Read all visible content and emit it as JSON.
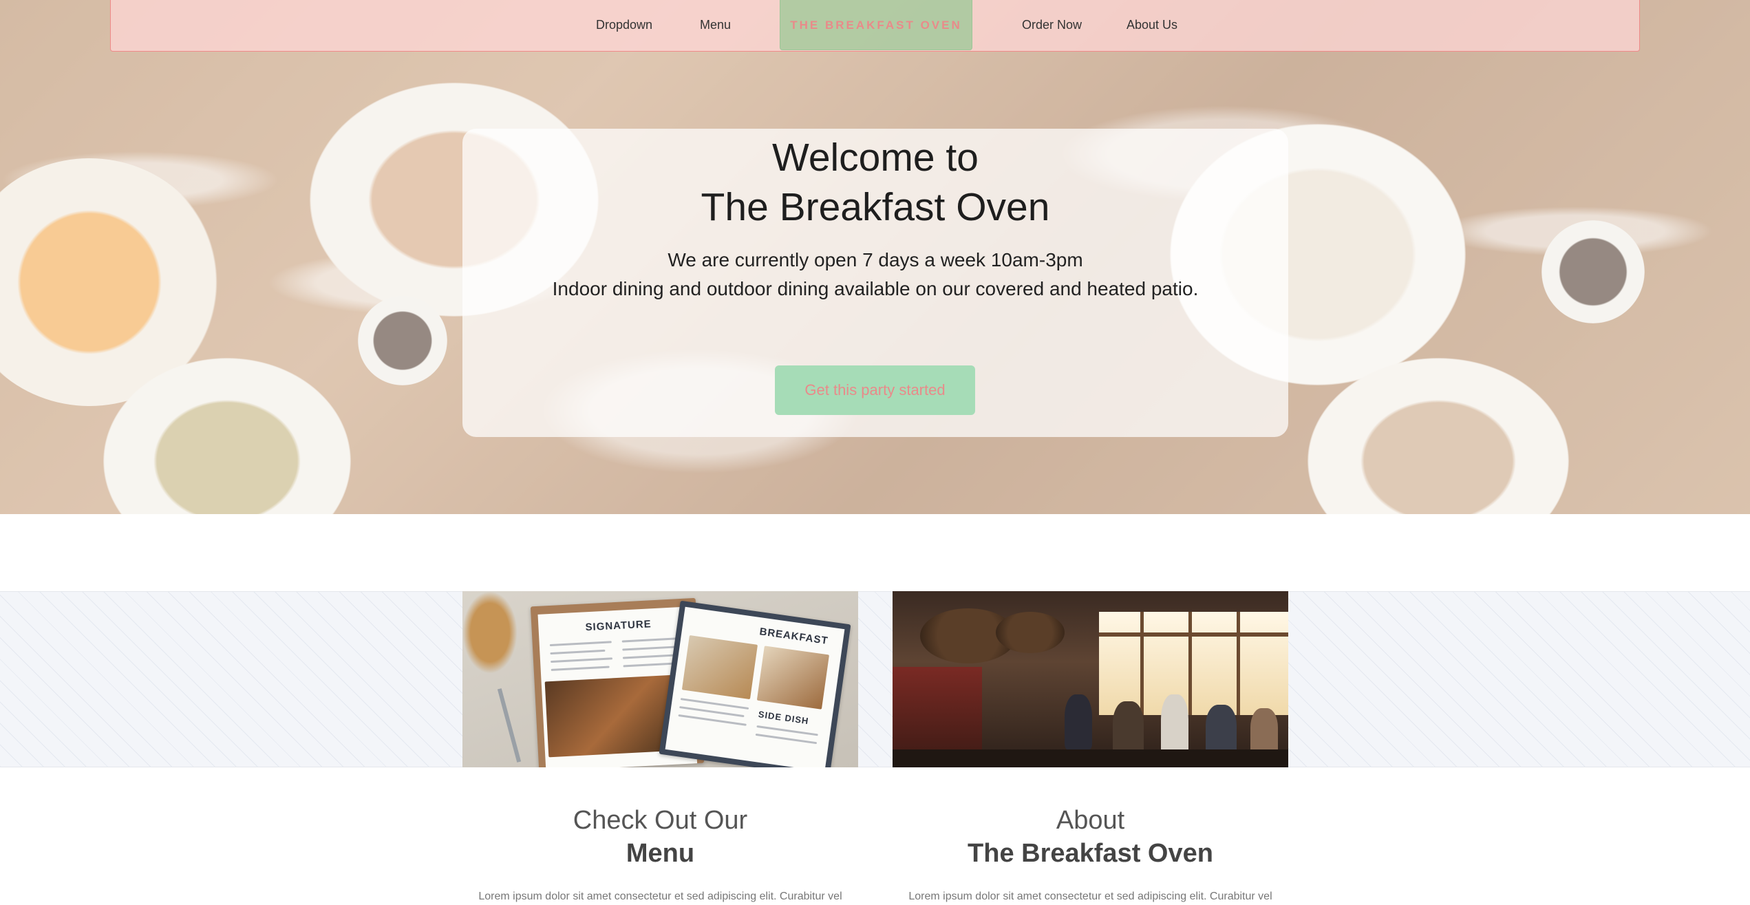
{
  "nav": {
    "links_left": [
      "Dropdown",
      "Menu"
    ],
    "brand": "THE BREAKFAST OVEN",
    "links_right": [
      "Order Now",
      "About Us"
    ]
  },
  "hero": {
    "title_line1": "Welcome to",
    "title_line2": "The Breakfast Oven",
    "subtitle_line1": "We are currently open 7 days a week 10am-3pm",
    "subtitle_line2": "Indoor dining and outdoor dining available on our covered and heated patio.",
    "cta_label": "Get this party started"
  },
  "menu_photo": {
    "sheet_left_title": "SIGNATURE",
    "sheet_right_title": "BREAKFAST",
    "sheet_right_section": "SIDE DISH"
  },
  "columns": {
    "menu": {
      "title_light": "Check Out Our",
      "title_bold": "Menu",
      "text": "Lorem ipsum dolor sit amet consectetur et sed adipiscing elit. Curabitur vel"
    },
    "about": {
      "title_light": "About",
      "title_bold": "The Breakfast Oven",
      "text": "Lorem ipsum dolor sit amet consectetur et sed adipiscing elit. Curabitur vel"
    }
  },
  "colors": {
    "nav_bg": "#ffd7d7",
    "nav_border": "#f08a8a",
    "brand_bg": "#9bc896",
    "brand_text": "#e98a8a",
    "cta_bg": "#a6dcb7",
    "cta_text": "#e98a8a"
  }
}
